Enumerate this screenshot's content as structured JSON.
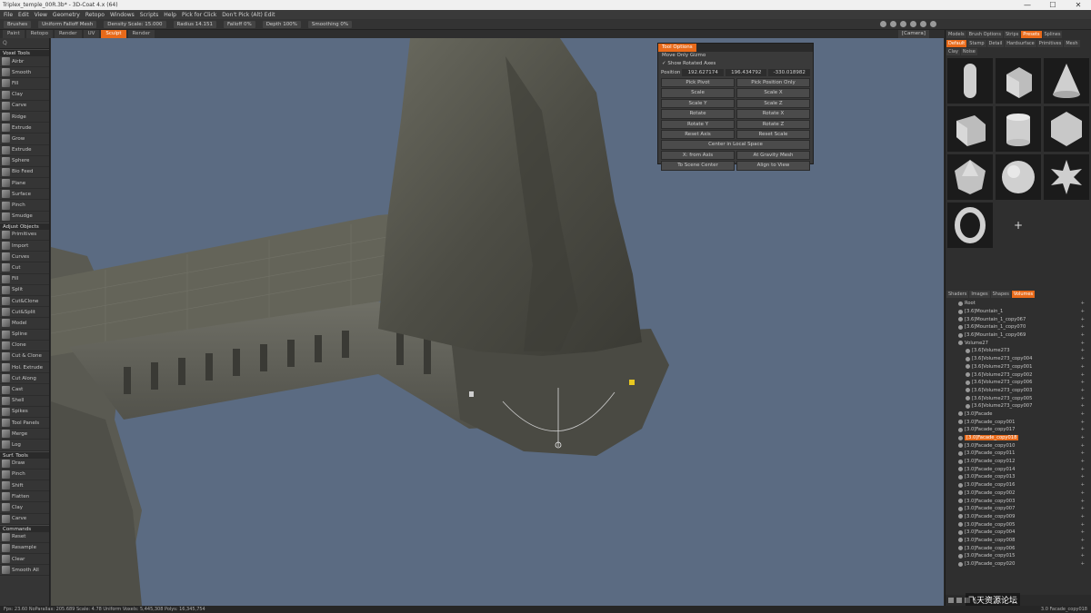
{
  "window": {
    "title": "Triplex_temple_00R.3b* - 3D-Coat 4.x (64)",
    "minimize": "—",
    "maximize": "☐",
    "close": "✕"
  },
  "menu": [
    "File",
    "Edit",
    "View",
    "Geometry",
    "Retopo",
    "Windows",
    "Scripts",
    "Help",
    "Pick for Click",
    "Don't Pick (Alt) Edit"
  ],
  "toolbar": {
    "brush": "Brushes",
    "falloff": "Uniform Falloff Mesh",
    "density": "Density Scale: 15.000",
    "radius": "Radius 14.151",
    "falloff_pct": "Falloff 0%",
    "depth": "Depth 100%",
    "smoothing": "Smoothing 0%"
  },
  "rooms": {
    "tabs": [
      "Paint",
      "Retopo",
      "Render",
      "UV",
      "Sculpt",
      "Render"
    ],
    "active_index": 4,
    "camera": "[Camera]"
  },
  "left_panel": {
    "search_placeholder": "Q",
    "sections": [
      {
        "header": "Voxel Tools",
        "items": [
          "Airbr",
          "Smooth",
          "Fill",
          "Clay",
          "Carve",
          "Ridge",
          "Extrude",
          "Grow",
          "Extrude",
          "Sphere",
          "Bio Feed",
          "Plane",
          "Surface",
          "Pinch",
          "Smudge"
        ]
      },
      {
        "header": "Adjust Objects",
        "items": [
          "Primitives",
          "Import",
          "Curves",
          "Cut",
          "Fill",
          "Split",
          "Cut&Clone",
          "Cut&Split",
          "Model",
          "Spline",
          "Clone",
          "Cut & Clone",
          "Hol. Extrude",
          "Cut Along",
          "Cast",
          "Shell",
          "Spikes",
          "Tool Panels",
          "Merge",
          "Log"
        ]
      },
      {
        "header": "Surf. Tools",
        "items": [
          "Draw",
          "Pinch",
          "Shift",
          "Flatten",
          "Clay",
          "Carve"
        ]
      },
      {
        "header": "Commands",
        "items": [
          "Reset",
          "Resample",
          "Clear",
          "Smooth All"
        ]
      }
    ]
  },
  "tool_options": {
    "title": "Tool Options",
    "check1": "Move Only Gizmo",
    "check2": "✓ Show Rotated Axes",
    "position_label": "Position",
    "position": [
      "192.627174",
      "196.434792",
      "-330.018982"
    ],
    "buttons": [
      "Pick Pivot",
      "Pick Position Only",
      "Scale",
      "Scale X",
      "Scale Y",
      "Scale Z",
      "Rotate",
      "Rotate X",
      "Rotate Y",
      "Rotate Z",
      "Reset Axis",
      "Reset Scale"
    ],
    "center": "Center in Local Space",
    "bottom": [
      "X: from Axis",
      "At Gravity Mesh",
      "To Scene Center",
      "Align to View"
    ]
  },
  "right_panel": {
    "top_tabs": [
      "Models",
      "Brush Options",
      "Strips",
      "Presets",
      "Splines"
    ],
    "top_active": 3,
    "sub_tabs": [
      "Default",
      "Stamp",
      "Detail",
      "Hardsurface",
      "Primitives",
      "Mesh",
      "Clay",
      "Noise"
    ],
    "sub_active": 0,
    "shapes": [
      "capsule-shape",
      "rounded-cube-shape",
      "cone-shape",
      "cube-shape",
      "cylinder-shape",
      "hexagon-shape",
      "icosahedron-shape",
      "sphere-shape",
      "star-shape",
      "torus-shape"
    ],
    "add_label": "+",
    "scene_tabs": [
      "Shaders",
      "Images",
      "Shapes",
      "Volumes"
    ],
    "scene_active": 3,
    "scene_items": [
      {
        "label": "Root",
        "indent": false,
        "selected": false
      },
      {
        "label": "[3.6]Mountain_1",
        "indent": false,
        "selected": false
      },
      {
        "label": "[3.6]Mountain_1_copy067",
        "indent": false,
        "selected": false
      },
      {
        "label": "[3.6]Mountain_1_copy070",
        "indent": false,
        "selected": false
      },
      {
        "label": "[3.6]Mountain_1_copy069",
        "indent": false,
        "selected": false
      },
      {
        "label": "Volume27",
        "indent": false,
        "selected": false
      },
      {
        "label": "[3.6]Volume273",
        "indent": true,
        "selected": false
      },
      {
        "label": "[3.6]Volume273_copy004",
        "indent": true,
        "selected": false
      },
      {
        "label": "[3.6]Volume273_copy001",
        "indent": true,
        "selected": false
      },
      {
        "label": "[3.6]Volume273_copy002",
        "indent": true,
        "selected": false
      },
      {
        "label": "[3.6]Volume273_copy006",
        "indent": true,
        "selected": false
      },
      {
        "label": "[3.6]Volume273_copy003",
        "indent": true,
        "selected": false
      },
      {
        "label": "[3.6]Volume273_copy005",
        "indent": true,
        "selected": false
      },
      {
        "label": "[3.6]Volume273_copy007",
        "indent": true,
        "selected": false
      },
      {
        "label": "[3.0]Facade",
        "indent": false,
        "selected": false
      },
      {
        "label": "[3.0]Facade_copy001",
        "indent": false,
        "selected": false
      },
      {
        "label": "[3.0]Facade_copy017",
        "indent": false,
        "selected": false
      },
      {
        "label": "[3.0]Facade_copy018",
        "indent": false,
        "selected": true
      },
      {
        "label": "[3.0]Facade_copy010",
        "indent": false,
        "selected": false
      },
      {
        "label": "[3.0]Facade_copy011",
        "indent": false,
        "selected": false
      },
      {
        "label": "[3.0]Facade_copy012",
        "indent": false,
        "selected": false
      },
      {
        "label": "[3.0]Facade_copy014",
        "indent": false,
        "selected": false
      },
      {
        "label": "[3.0]Facade_copy013",
        "indent": false,
        "selected": false
      },
      {
        "label": "[3.0]Facade_copy016",
        "indent": false,
        "selected": false
      },
      {
        "label": "[3.0]Facade_copy002",
        "indent": false,
        "selected": false
      },
      {
        "label": "[3.0]Facade_copy003",
        "indent": false,
        "selected": false
      },
      {
        "label": "[3.0]Facade_copy007",
        "indent": false,
        "selected": false
      },
      {
        "label": "[3.0]Facade_copy009",
        "indent": false,
        "selected": false
      },
      {
        "label": "[3.0]Facade_copy005",
        "indent": false,
        "selected": false
      },
      {
        "label": "[3.0]Facade_copy004",
        "indent": false,
        "selected": false
      },
      {
        "label": "[3.0]Facade_copy008",
        "indent": false,
        "selected": false
      },
      {
        "label": "[3.0]Facade_copy006",
        "indent": false,
        "selected": false
      },
      {
        "label": "[3.0]Facade_copy015",
        "indent": false,
        "selected": false
      },
      {
        "label": "[3.0]Facade_copy020",
        "indent": false,
        "selected": false
      }
    ]
  },
  "watermark": "飞天资源论坛",
  "status": {
    "left": "Fps: 23.60  NoParallax: 205.689    Scale: 4.78  Uniform  Voxels: 5,445,308  Polys: 16,345,754",
    "right": "3.0 Facade_copy018"
  },
  "colors": {
    "accent": "#e86a1a",
    "viewport_bg": "#5b6b82",
    "panel_bg": "#353535"
  }
}
